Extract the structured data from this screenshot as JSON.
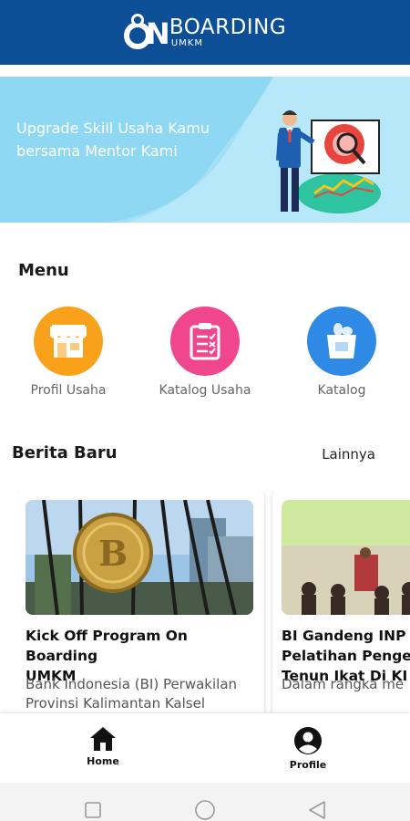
{
  "header": {
    "logo_main": "BOARDING",
    "logo_sub": "UMKM",
    "logo_on": "N"
  },
  "banner": {
    "text": "Upgrade Skill Usaha Kamu bersama Mentor Kami"
  },
  "menu": {
    "title": "Menu",
    "items": [
      {
        "label": "Profil Usaha",
        "icon": "store-icon",
        "color": "#f9a11b"
      },
      {
        "label": "Katalog Usaha",
        "icon": "clipboard-checklist-icon",
        "color": "#f0468d"
      },
      {
        "label": "Katalog",
        "icon": "grocery-bag-icon",
        "color": "#2f8ae6"
      }
    ]
  },
  "news": {
    "title": "Berita Baru",
    "more_label": "Lainnya",
    "cards": [
      {
        "title": "Kick Off Program On Boarding\nUMKM",
        "desc": "Bank Indonesia (BI) Perwakilan\nProvinsi  Kalimantan Kalsel"
      },
      {
        "title": "BI Gandeng INP\nPelatihan Penge\nTenun Ikat Di KI",
        "desc": "Dalam rangka me"
      }
    ]
  },
  "bottom_nav": {
    "items": [
      {
        "label": "Home",
        "icon": "home-icon"
      },
      {
        "label": "Profile",
        "icon": "account-circle-icon"
      }
    ]
  },
  "system_nav": {
    "buttons": [
      "recent-apps-icon",
      "home-circle-icon",
      "back-triangle-icon"
    ]
  },
  "colors": {
    "header": "#0d4f96",
    "banner": "#8fd8f4"
  }
}
